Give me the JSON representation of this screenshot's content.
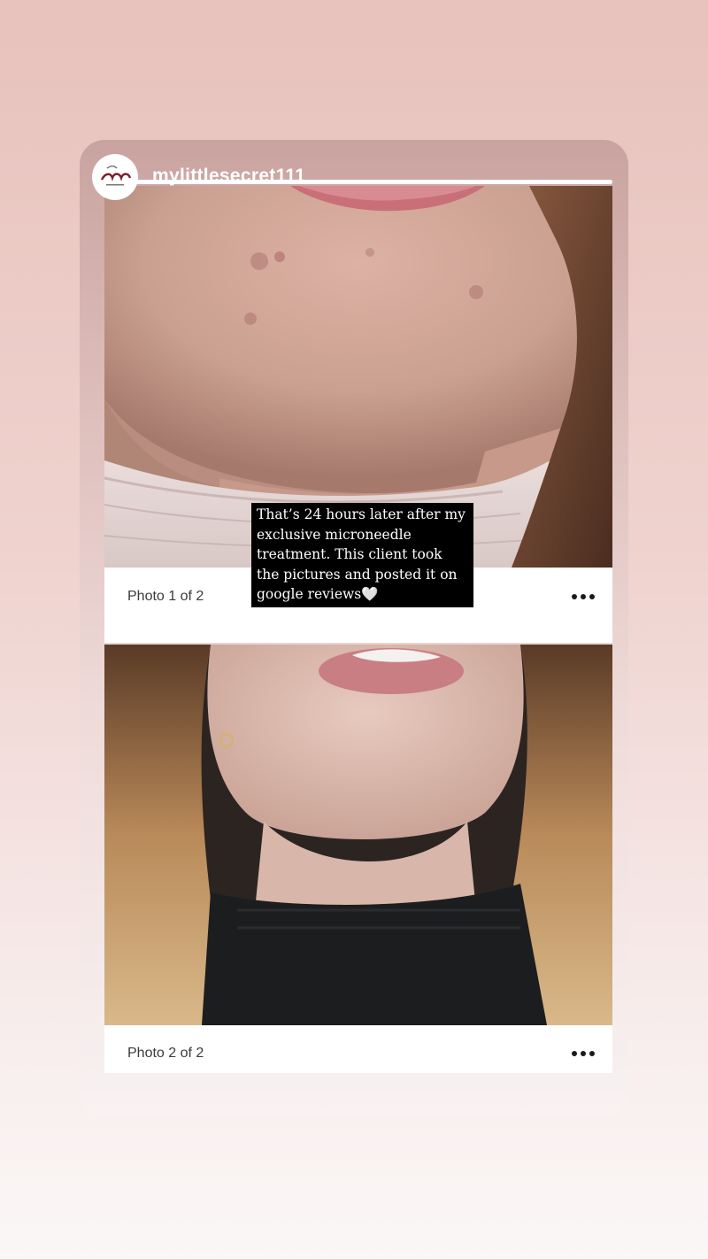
{
  "story": {
    "username": "mylittlesecret111",
    "avatar_icon": "brand-logo-icon",
    "progress": 1.0,
    "overlay_text": "That’s 24 hours later after my\nexclusive microneedle\ntreatment. This client took\nthe pictures and posted it on\ngoogle reviews🤍"
  },
  "photos": [
    {
      "caption": "Photo 1 of 2",
      "menu_icon": "more-options-icon"
    },
    {
      "caption": "Photo 2 of 2",
      "menu_icon": "more-options-icon"
    }
  ],
  "colors": {
    "background_top": "#e8c2bc",
    "background_bottom": "#fbf7f7",
    "text_overlay_bg": "#000000",
    "text_overlay_fg": "#ffffff"
  }
}
